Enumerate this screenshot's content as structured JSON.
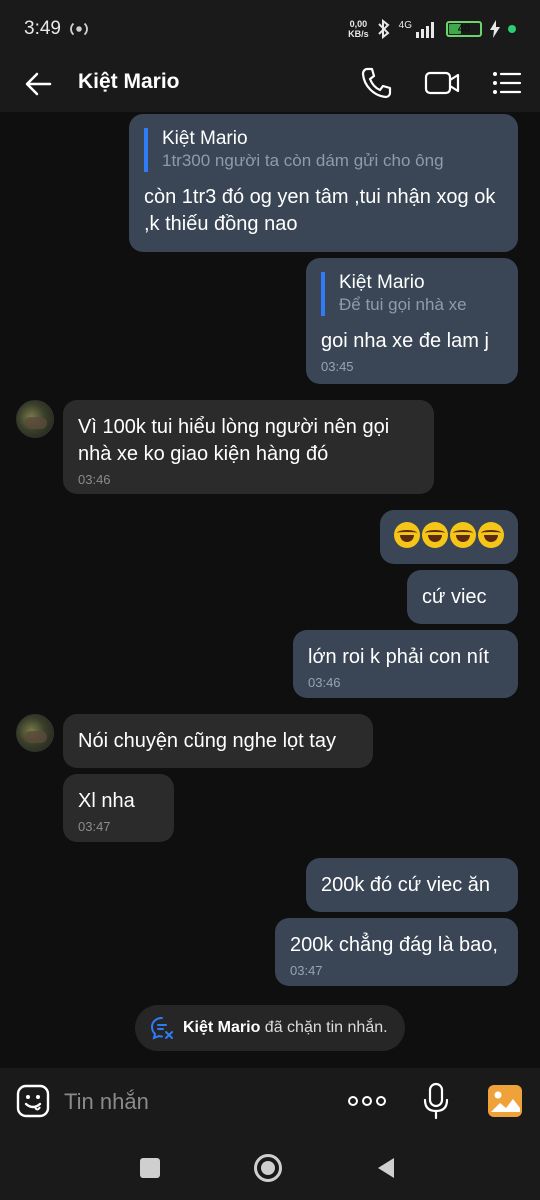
{
  "status_bar": {
    "time": "3:49",
    "net_speed_value": "0,00",
    "net_speed_unit": "KB/s",
    "network": "4G",
    "battery": "40"
  },
  "header": {
    "title": "Kiệt Mario"
  },
  "messages": [
    {
      "side": "me",
      "reply_to_name": "Kiệt Mario",
      "reply_to_text": "1tr300 người ta còn dám gửi cho ông",
      "text": "còn 1tr3 đó og yen tâm ,tui nhận xog ok ,k thiếu đồng nao"
    },
    {
      "side": "me",
      "reply_to_name": "Kiệt Mario",
      "reply_to_text": "Để tui gọi nhà xe",
      "text": "goi nha xe đe lam j",
      "time": "03:45"
    },
    {
      "side": "them",
      "text": "Vì 100k tui hiểu lòng người nên gọi nhà xe ko giao kiện hàng đó",
      "time": "03:46"
    },
    {
      "side": "me",
      "emoji": "🤣🤣🤣🤣"
    },
    {
      "side": "me",
      "text": "cứ viec"
    },
    {
      "side": "me",
      "text": "lớn roi k phải con nít",
      "time": "03:46"
    },
    {
      "side": "them",
      "text": "Nói chuyện cũng nghe lọt tay"
    },
    {
      "side": "them",
      "text": "Xl nha",
      "time": "03:47"
    },
    {
      "side": "me",
      "text": "200k đó cứ viec ăn"
    },
    {
      "side": "me",
      "text": "200k chẳng đág là bao,",
      "time": "03:47"
    }
  ],
  "notice": {
    "name": "Kiệt Mario",
    "text": "đã chặn tin nhắn."
  },
  "composer": {
    "placeholder": "Tin nhắn"
  },
  "colors": {
    "my_bubble": "#3a4655",
    "their_bubble": "#2b2b2b",
    "quote_bar": "#2f7cf6",
    "image_button": "#f0a23a"
  }
}
